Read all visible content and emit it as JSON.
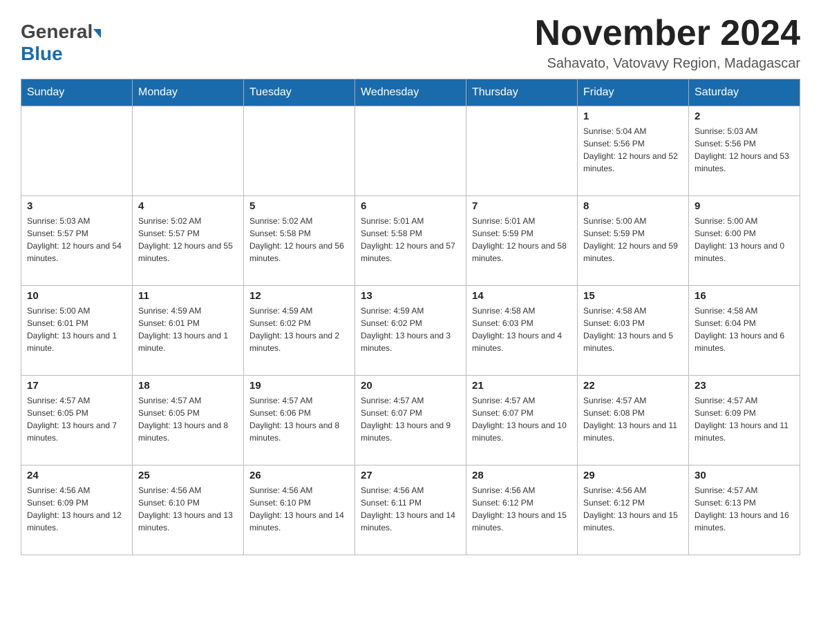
{
  "header": {
    "logo": {
      "general": "General",
      "blue": "Blue",
      "arrow": "▶"
    },
    "title": "November 2024",
    "subtitle": "Sahavato, Vatovavy Region, Madagascar"
  },
  "calendar": {
    "days_of_week": [
      "Sunday",
      "Monday",
      "Tuesday",
      "Wednesday",
      "Thursday",
      "Friday",
      "Saturday"
    ],
    "weeks": [
      [
        {
          "day": "",
          "info": ""
        },
        {
          "day": "",
          "info": ""
        },
        {
          "day": "",
          "info": ""
        },
        {
          "day": "",
          "info": ""
        },
        {
          "day": "",
          "info": ""
        },
        {
          "day": "1",
          "info": "Sunrise: 5:04 AM\nSunset: 5:56 PM\nDaylight: 12 hours and 52 minutes."
        },
        {
          "day": "2",
          "info": "Sunrise: 5:03 AM\nSunset: 5:56 PM\nDaylight: 12 hours and 53 minutes."
        }
      ],
      [
        {
          "day": "3",
          "info": "Sunrise: 5:03 AM\nSunset: 5:57 PM\nDaylight: 12 hours and 54 minutes."
        },
        {
          "day": "4",
          "info": "Sunrise: 5:02 AM\nSunset: 5:57 PM\nDaylight: 12 hours and 55 minutes."
        },
        {
          "day": "5",
          "info": "Sunrise: 5:02 AM\nSunset: 5:58 PM\nDaylight: 12 hours and 56 minutes."
        },
        {
          "day": "6",
          "info": "Sunrise: 5:01 AM\nSunset: 5:58 PM\nDaylight: 12 hours and 57 minutes."
        },
        {
          "day": "7",
          "info": "Sunrise: 5:01 AM\nSunset: 5:59 PM\nDaylight: 12 hours and 58 minutes."
        },
        {
          "day": "8",
          "info": "Sunrise: 5:00 AM\nSunset: 5:59 PM\nDaylight: 12 hours and 59 minutes."
        },
        {
          "day": "9",
          "info": "Sunrise: 5:00 AM\nSunset: 6:00 PM\nDaylight: 13 hours and 0 minutes."
        }
      ],
      [
        {
          "day": "10",
          "info": "Sunrise: 5:00 AM\nSunset: 6:01 PM\nDaylight: 13 hours and 1 minute."
        },
        {
          "day": "11",
          "info": "Sunrise: 4:59 AM\nSunset: 6:01 PM\nDaylight: 13 hours and 1 minute."
        },
        {
          "day": "12",
          "info": "Sunrise: 4:59 AM\nSunset: 6:02 PM\nDaylight: 13 hours and 2 minutes."
        },
        {
          "day": "13",
          "info": "Sunrise: 4:59 AM\nSunset: 6:02 PM\nDaylight: 13 hours and 3 minutes."
        },
        {
          "day": "14",
          "info": "Sunrise: 4:58 AM\nSunset: 6:03 PM\nDaylight: 13 hours and 4 minutes."
        },
        {
          "day": "15",
          "info": "Sunrise: 4:58 AM\nSunset: 6:03 PM\nDaylight: 13 hours and 5 minutes."
        },
        {
          "day": "16",
          "info": "Sunrise: 4:58 AM\nSunset: 6:04 PM\nDaylight: 13 hours and 6 minutes."
        }
      ],
      [
        {
          "day": "17",
          "info": "Sunrise: 4:57 AM\nSunset: 6:05 PM\nDaylight: 13 hours and 7 minutes."
        },
        {
          "day": "18",
          "info": "Sunrise: 4:57 AM\nSunset: 6:05 PM\nDaylight: 13 hours and 8 minutes."
        },
        {
          "day": "19",
          "info": "Sunrise: 4:57 AM\nSunset: 6:06 PM\nDaylight: 13 hours and 8 minutes."
        },
        {
          "day": "20",
          "info": "Sunrise: 4:57 AM\nSunset: 6:07 PM\nDaylight: 13 hours and 9 minutes."
        },
        {
          "day": "21",
          "info": "Sunrise: 4:57 AM\nSunset: 6:07 PM\nDaylight: 13 hours and 10 minutes."
        },
        {
          "day": "22",
          "info": "Sunrise: 4:57 AM\nSunset: 6:08 PM\nDaylight: 13 hours and 11 minutes."
        },
        {
          "day": "23",
          "info": "Sunrise: 4:57 AM\nSunset: 6:09 PM\nDaylight: 13 hours and 11 minutes."
        }
      ],
      [
        {
          "day": "24",
          "info": "Sunrise: 4:56 AM\nSunset: 6:09 PM\nDaylight: 13 hours and 12 minutes."
        },
        {
          "day": "25",
          "info": "Sunrise: 4:56 AM\nSunset: 6:10 PM\nDaylight: 13 hours and 13 minutes."
        },
        {
          "day": "26",
          "info": "Sunrise: 4:56 AM\nSunset: 6:10 PM\nDaylight: 13 hours and 14 minutes."
        },
        {
          "day": "27",
          "info": "Sunrise: 4:56 AM\nSunset: 6:11 PM\nDaylight: 13 hours and 14 minutes."
        },
        {
          "day": "28",
          "info": "Sunrise: 4:56 AM\nSunset: 6:12 PM\nDaylight: 13 hours and 15 minutes."
        },
        {
          "day": "29",
          "info": "Sunrise: 4:56 AM\nSunset: 6:12 PM\nDaylight: 13 hours and 15 minutes."
        },
        {
          "day": "30",
          "info": "Sunrise: 4:57 AM\nSunset: 6:13 PM\nDaylight: 13 hours and 16 minutes."
        }
      ]
    ]
  }
}
